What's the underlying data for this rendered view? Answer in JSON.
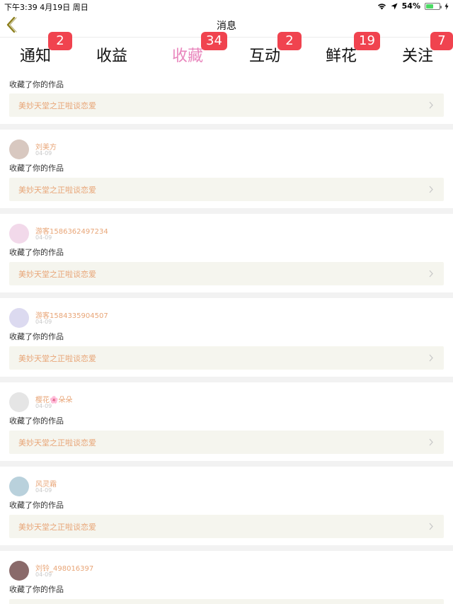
{
  "status_bar": {
    "time_date": "下午3:39   4月19日 周日",
    "battery": "54%",
    "battery_level": 0.54,
    "battery_color": "#4cd964"
  },
  "nav": {
    "title": "消息",
    "back_icon": "chevron-left-icon",
    "back_color": "#8b7d1a"
  },
  "tabs": [
    {
      "label": "通知",
      "badge": "2"
    },
    {
      "label": "收益",
      "badge": ""
    },
    {
      "label": "收藏",
      "badge": "34",
      "active": true
    },
    {
      "label": "互动",
      "badge": "2"
    },
    {
      "label": "鲜花",
      "badge": "19"
    },
    {
      "label": "关注",
      "badge": "7"
    }
  ],
  "theme": {
    "accent": "#e986bd",
    "badge": "#f0434f",
    "name_color": "#e8a577"
  },
  "feed": [
    {
      "name": "",
      "date": "",
      "action": "收藏了你的作品",
      "work": "美妙天堂之正啦谈恋爱"
    },
    {
      "name": "刘美方",
      "date": "04-09",
      "action": "收藏了你的作品",
      "work": "美妙天堂之正啦谈恋爱"
    },
    {
      "name": "游客1586362497234",
      "date": "04-09",
      "action": "收藏了你的作品",
      "work": "美妙天堂之正啦谈恋爱"
    },
    {
      "name": "游客1584335904507",
      "date": "04-09",
      "action": "收藏了你的作品",
      "work": "美妙天堂之正啦谈恋爱"
    },
    {
      "name": "樱花🌸朵朵",
      "date": "04-09",
      "action": "收藏了你的作品",
      "work": "美妙天堂之正啦谈恋爱"
    },
    {
      "name": "风灵霜",
      "date": "04-09",
      "action": "收藏了你的作品",
      "work": "美妙天堂之正啦谈恋爱"
    },
    {
      "name": "刘铃_498016397",
      "date": "04-09",
      "action": "收藏了你的作品",
      "work": ""
    }
  ]
}
